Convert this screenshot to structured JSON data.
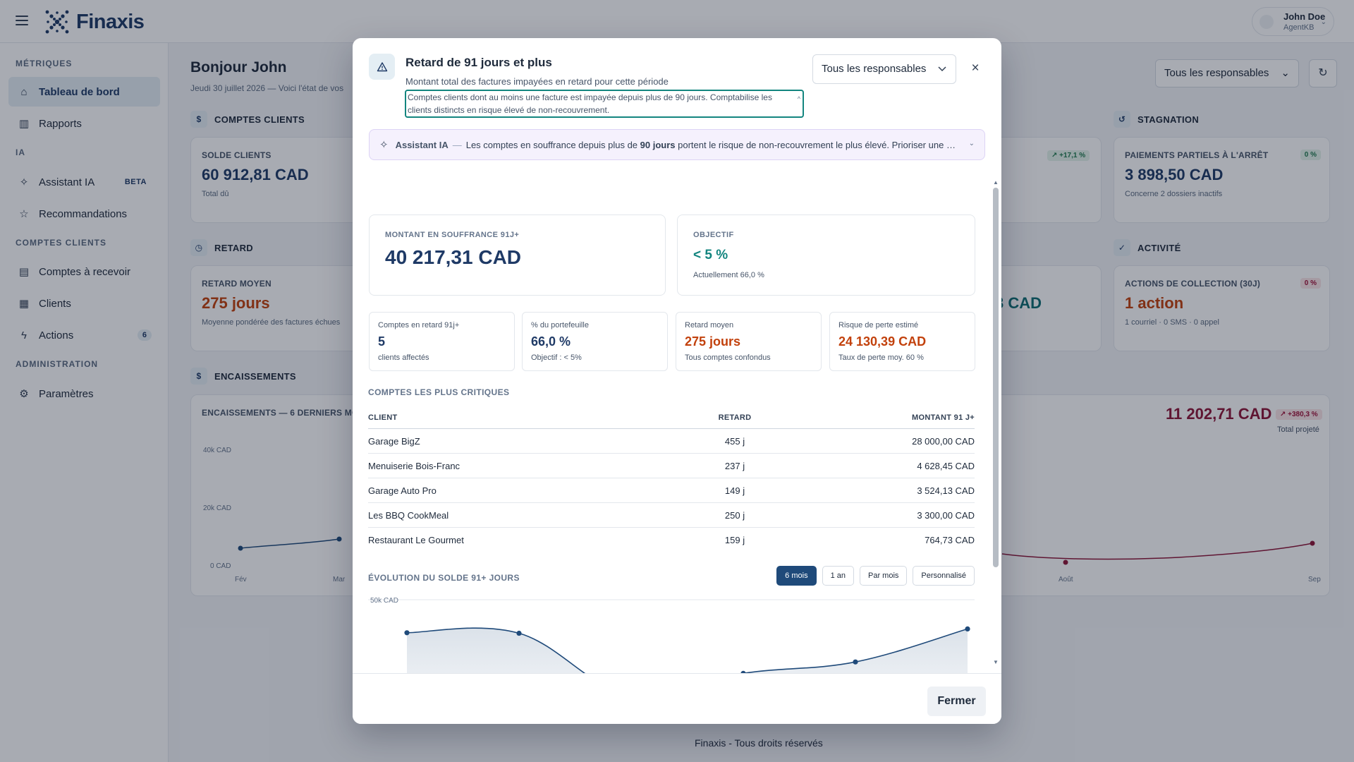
{
  "app": {
    "brand": "Finaxis",
    "user": {
      "name": "John Doe",
      "role": "AgentKB"
    }
  },
  "sidebar": {
    "sections": [
      {
        "label": "MÉTRIQUES"
      },
      {
        "label": "IA"
      },
      {
        "label": "COMPTES CLIENTS"
      },
      {
        "label": "ADMINISTRATION"
      }
    ],
    "items": [
      {
        "label": "Tableau de bord",
        "icon": "home-icon"
      },
      {
        "label": "Rapports",
        "icon": "bar-chart-icon"
      },
      {
        "label": "Assistant IA",
        "icon": "sparkle-icon",
        "badge": "BETA"
      },
      {
        "label": "Recommandations",
        "icon": "star-icon"
      },
      {
        "label": "Comptes à recevoir",
        "icon": "document-icon"
      },
      {
        "label": "Clients",
        "icon": "building-icon"
      },
      {
        "label": "Actions",
        "icon": "bolt-icon",
        "badge": "6"
      },
      {
        "label": "Paramètres",
        "icon": "gear-icon"
      }
    ]
  },
  "dashboard": {
    "greeting": "Bonjour John",
    "subtitle": "Jeudi 30 juillet 2026 — Voici l'état de vos",
    "responsable_select": "Tous les responsables",
    "sections": {
      "comptes": "COMPTES CLIENTS",
      "stagnation": "STAGNATION",
      "retard": "RETARD",
      "activite": "ACTIVITÉ",
      "encaissements": "ENCAISSEMENTS"
    },
    "cards": {
      "solde": {
        "label": "SOLDE CLIENTS",
        "value": "60 912,81 CAD",
        "note": "Total dû"
      },
      "partiels": {
        "label": "PAIEMENTS PARTIELS À L'ARRÊT",
        "value": "3 898,50 CAD",
        "note": "Concerne 2 dossiers inactifs",
        "pill": "0 %"
      },
      "trend_pill": "↗ +17,1 %",
      "retard_moyen": {
        "label": "RETARD MOYEN",
        "value": "275 jours",
        "note": "Moyenne pondérée des factures échues"
      },
      "retard_partial_value": "3 CAD",
      "actions": {
        "label": "ACTIONS DE COLLECTION (30J)",
        "value": "1 action",
        "note": "1 courriel · 0 SMS · 0 appel",
        "pill": "0 %"
      },
      "encaissements": {
        "label": "ENCAISSEMENTS — 6 DERNIERS MOIS",
        "projected": "11 202,71 CAD",
        "projected_note": "Total projeté",
        "pill": "↗ +380,3 %"
      }
    },
    "enc_chart": {
      "y_ticks": [
        "40k CAD",
        "20k CAD",
        "0 CAD"
      ],
      "x_left": [
        "Fév",
        "Mar"
      ],
      "x_right": [
        "Août",
        "Sep"
      ]
    },
    "footer": "Finaxis - Tous droits réservés"
  },
  "modal": {
    "title": "Retard de 91 jours et plus",
    "subtitle": "Montant total des factures impayées en retard pour cette période",
    "description": "Comptes clients dont au moins une facture est impayée depuis plus de 90 jours. Comptabilise les clients distincts en risque élevé de non-recouvrement.",
    "responsable_select": "Tous les responsables",
    "ai": {
      "name": "Assistant IA",
      "text_before": "Les comptes en souffrance depuis plus de ",
      "text_bold": "90 jours",
      "text_after": " portent le risque de non-recouvrement le plus élevé. Prioriser une cel..."
    },
    "amount_card": {
      "label": "MONTANT EN SOUFFRANCE 91J+",
      "value": "40 217,31 CAD"
    },
    "objective_card": {
      "label": "OBJECTIF",
      "value": "< 5 %",
      "note": "Actuellement 66,0 %"
    },
    "stats": [
      {
        "label": "Comptes en retard 91j+",
        "value": "5",
        "note": "clients affectés"
      },
      {
        "label": "% du portefeuille",
        "value": "66,0 %",
        "note": "Objectif : < 5%"
      },
      {
        "label": "Retard moyen",
        "value": "275 jours",
        "note": "Tous comptes confondus"
      },
      {
        "label": "Risque de perte estimé",
        "value": "24 130,39 CAD",
        "note": "Taux de perte moy. 60 %"
      }
    ],
    "table": {
      "title": "COMPTES LES PLUS CRITIQUES",
      "headers": {
        "client": "CLIENT",
        "retard": "RETARD",
        "amount": "MONTANT 91 J+"
      },
      "rows": [
        {
          "client": "Garage BigZ",
          "retard": "455 j",
          "amount": "28 000,00 CAD"
        },
        {
          "client": "Menuiserie Bois-Franc",
          "retard": "237 j",
          "amount": "4 628,45 CAD"
        },
        {
          "client": "Garage Auto Pro",
          "retard": "149 j",
          "amount": "3 524,13 CAD"
        },
        {
          "client": "Les BBQ CookMeal",
          "retard": "250 j",
          "amount": "3 300,00 CAD"
        },
        {
          "client": "Restaurant Le Gourmet",
          "retard": "159 j",
          "amount": "764,73 CAD"
        }
      ]
    },
    "evolution": {
      "title": "ÉVOLUTION DU SOLDE 91+ JOURS",
      "buttons": [
        "6 mois",
        "1 an",
        "Par mois",
        "Personnalisé"
      ],
      "active": "6 mois",
      "y_label": "50k CAD"
    },
    "close_label": "Fermer"
  },
  "chart_data": {
    "type": "area",
    "title": "ÉVOLUTION DU SOLDE 91+ JOURS",
    "ylabel": "",
    "xlabel": "",
    "ylim": [
      0,
      50000
    ],
    "y_ticks": [
      "50k CAD"
    ],
    "series": [
      {
        "values": [
          37000,
          36800,
          12000,
          21000,
          25500,
          38500
        ]
      }
    ]
  },
  "colors": {
    "brand": "#1f3a66",
    "accent_teal": "#13857f",
    "warning": "#c2410c"
  }
}
